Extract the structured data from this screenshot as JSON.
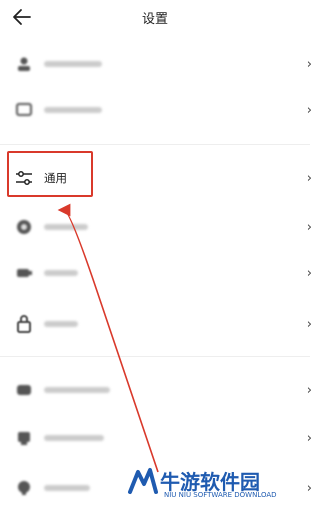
{
  "header": {
    "title": "设置",
    "back_icon": "arrow-left-icon"
  },
  "rows": [
    {
      "icon": "user-icon"
    },
    {
      "icon": "chat-icon"
    },
    {
      "icon": "sliders-icon",
      "label": "通用"
    },
    {
      "icon": "palette-icon"
    },
    {
      "icon": "toggle-icon"
    },
    {
      "icon": "lock-icon"
    },
    {
      "icon": "shield-icon"
    },
    {
      "icon": "info-icon"
    },
    {
      "icon": "help-icon"
    }
  ],
  "chevron": "›",
  "highlight_color": "#d9392b",
  "watermark": {
    "name": "牛游软件园",
    "subtitle": "NIU NIU SOFTWARE DOWNLOAD",
    "color": "#1f5bb0"
  }
}
